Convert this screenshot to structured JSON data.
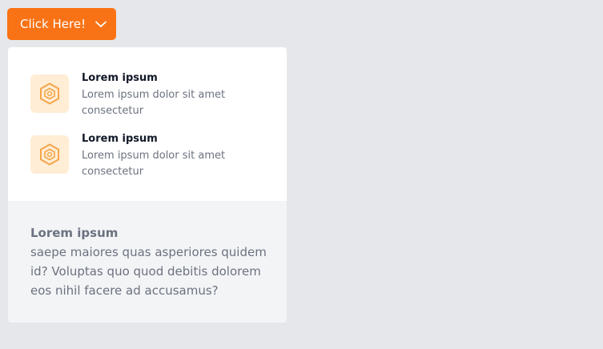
{
  "trigger": {
    "label": "Click Here!",
    "icon": "chevron-down-icon",
    "color": "#f97316"
  },
  "menu": {
    "items": [
      {
        "title": "Lorem ipsum",
        "description": "Lorem ipsum dolor sit amet consectetur",
        "icon": "hexagon-icon"
      },
      {
        "title": "Lorem ipsum",
        "description": "Lorem ipsum dolor sit amet consectetur",
        "icon": "hexagon-icon"
      }
    ],
    "footer": {
      "title": "Lorem ipsum",
      "body": "saepe maiores quas asperiores quidem id? Voluptas quo quod debitis dolorem eos nihil facere ad accusamus?"
    }
  },
  "colors": {
    "accent": "#f97316",
    "icon_tile": "#ffedd5",
    "icon_stroke": "#f59e0b",
    "page_background": "#e5e7eb",
    "footer_background": "#f3f4f6"
  }
}
